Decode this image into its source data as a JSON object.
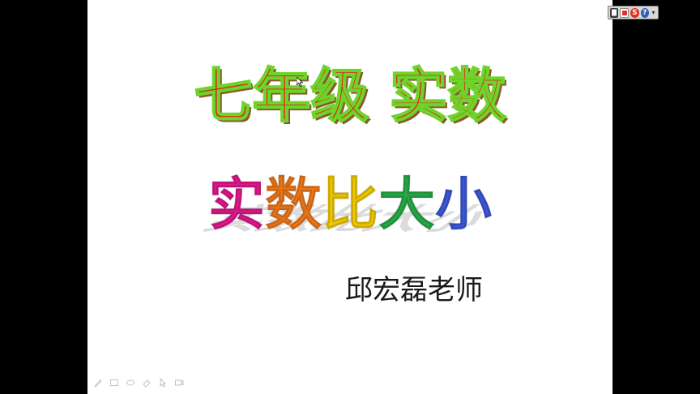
{
  "slide": {
    "title": "七年级 实数",
    "subtitle_chars": [
      {
        "ch": "实",
        "color": "#e0188c"
      },
      {
        "ch": "数",
        "color": "#f07818"
      },
      {
        "ch": "比",
        "color": "#f0c800"
      },
      {
        "ch": "大",
        "color": "#28a848"
      },
      {
        "ch": "小",
        "color": "#3a58d8"
      }
    ],
    "author": "邱宏磊老师"
  },
  "colors": {
    "title_fill": "#e8201a",
    "title_outline": "#6dd42a",
    "background": "#ffffff",
    "frame": "#000000"
  },
  "slideshow_toolbar": {
    "icons": [
      "pen-icon",
      "slides-icon",
      "pointer-icon",
      "eraser-icon",
      "arrow-icon",
      "screen-icon"
    ]
  },
  "tray": {
    "icons": [
      "document-icon",
      "page-icon",
      "s-icon",
      "help-icon",
      "menu-arrow-icon"
    ]
  }
}
